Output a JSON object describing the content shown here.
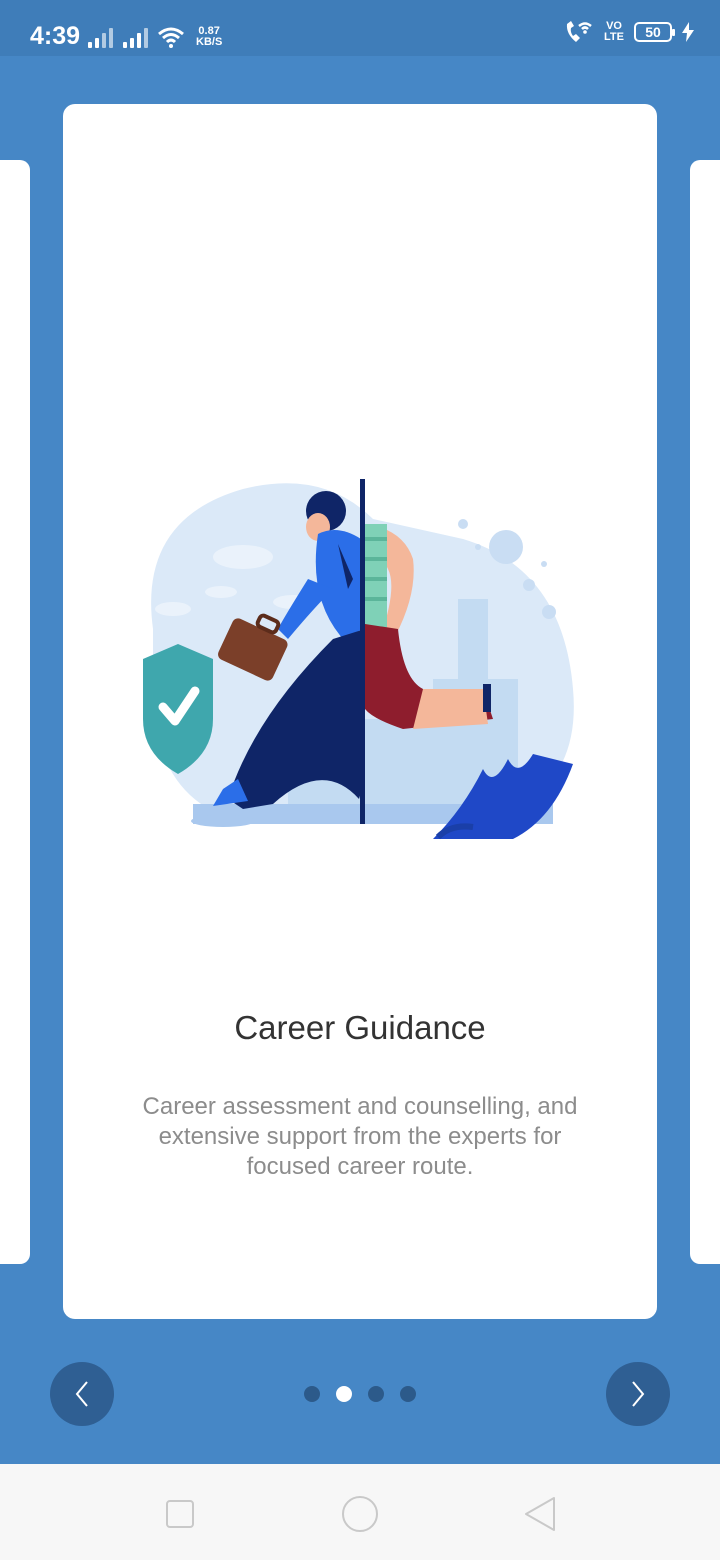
{
  "status_bar": {
    "time": "4:39",
    "speed_value": "0.87",
    "speed_unit": "KB/S",
    "volte_top": "VO",
    "volte_bottom": "LTE",
    "battery": "50",
    "icons": [
      "signal-icon",
      "signal-icon",
      "wifi-icon",
      "wifi-calling-icon",
      "charging-icon"
    ]
  },
  "slide": {
    "illustration": "career-runner-illustration",
    "title": "Career Guidance",
    "description": "Career assessment and counselling, and extensive support from the experts for focused career route."
  },
  "pager": {
    "prev_icon": "chevron-left-icon",
    "next_icon": "chevron-right-icon",
    "dots": 4,
    "active_index": 1
  },
  "system_nav": {
    "icons": [
      "recent-apps-icon",
      "home-icon",
      "back-icon"
    ]
  },
  "colors": {
    "background": "#4687c6",
    "status_bar": "#3f7db9",
    "nav_button": "#2f5f93",
    "card": "#ffffff"
  }
}
